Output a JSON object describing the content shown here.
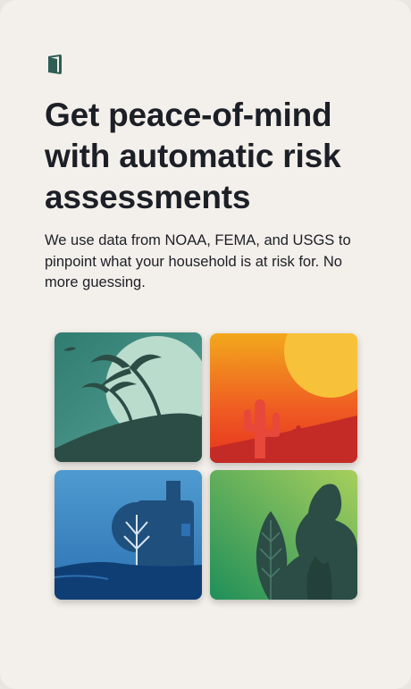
{
  "onboarding": {
    "logo_icon": "door-icon",
    "headline": "Get peace-of-mind with automatic risk assessments",
    "description": "We use data from NOAA, FEMA, and USGS to pinpoint what your household is at risk for. No more guessing."
  },
  "illustrations": [
    {
      "name": "hurricane-illustration",
      "icon": "palm-tree-wind"
    },
    {
      "name": "heat-illustration",
      "icon": "cactus-sun"
    },
    {
      "name": "flood-illustration",
      "icon": "house-flood"
    },
    {
      "name": "wildfire-illustration",
      "icon": "leaf-flame"
    }
  ],
  "colors": {
    "background": "#f3efea",
    "text": "#1c1f26",
    "logo": "#2d5e55"
  }
}
